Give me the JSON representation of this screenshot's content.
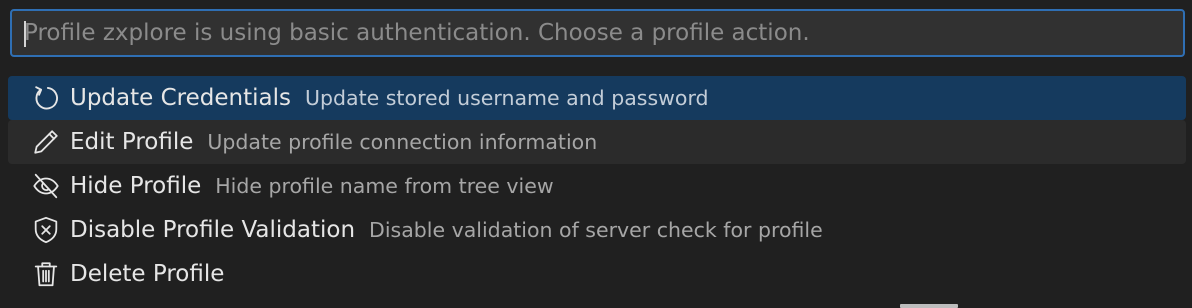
{
  "quick_pick": {
    "input": {
      "value": "",
      "placeholder": "Profile zxplore is using basic authentication. Choose a profile action."
    },
    "items": [
      {
        "label": "Update Credentials",
        "description": "Update stored username and password",
        "icon": "refresh-icon",
        "state": "selected"
      },
      {
        "label": "Edit Profile",
        "description": "Update profile connection information",
        "icon": "pencil-icon",
        "state": "hover"
      },
      {
        "label": "Hide Profile",
        "description": "Hide profile name from tree view",
        "icon": "eye-closed-icon",
        "state": "normal"
      },
      {
        "label": "Disable Profile Validation",
        "description": "Disable validation of server check for profile",
        "icon": "shield-x-icon",
        "state": "normal"
      },
      {
        "label": "Delete Profile",
        "description": "",
        "icon": "trash-icon",
        "state": "normal"
      }
    ]
  },
  "colors": {
    "background": "#202020",
    "input_border": "#2f6fb4",
    "selected_row": "#153a5e",
    "hover_row": "#2b2b2b",
    "label": "#e6e6e6",
    "description": "#a6a6a6"
  }
}
